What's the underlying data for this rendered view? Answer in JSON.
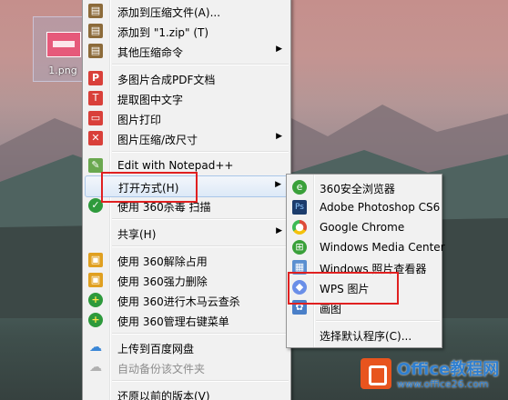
{
  "desktop": {
    "file_name": "1.png"
  },
  "context_menu": {
    "items": [
      {
        "label": "添加到压缩文件(A)...",
        "icon": "archive-icon",
        "color": "#7a5a2a"
      },
      {
        "label": "添加到 \"1.zip\" (T)",
        "icon": "archive-icon",
        "color": "#7a5a2a"
      },
      {
        "label": "其他压缩命令",
        "icon": "archive-icon",
        "color": "#7a5a2a"
      },
      {
        "label": "多图片合成PDF文档",
        "icon": "pdf-icon",
        "color": "#d9403a"
      },
      {
        "label": "提取图中文字",
        "icon": "text-extract-icon",
        "color": "#d9403a"
      },
      {
        "label": "图片打印",
        "icon": "print-icon",
        "color": "#d9403a"
      },
      {
        "label": "图片压缩/改尺寸",
        "icon": "resize-icon",
        "color": "#d9403a"
      },
      {
        "label": "Edit with Notepad++",
        "icon": "notepad-icon",
        "color": "#6aa84f"
      },
      {
        "label": "打开方式(H)",
        "icon": "",
        "color": ""
      },
      {
        "label": "使用 360杀毒 扫描",
        "icon": "shield-icon",
        "color": "#2e9a3c"
      },
      {
        "label": "共享(H)",
        "icon": "",
        "color": ""
      },
      {
        "label": "使用 360解除占用",
        "icon": "unlock-icon",
        "color": "#e0a020"
      },
      {
        "label": "使用 360强力删除",
        "icon": "delete-icon",
        "color": "#e0a020"
      },
      {
        "label": "使用 360进行木马云查杀",
        "icon": "plus-icon",
        "color": "#2e9a3c"
      },
      {
        "label": "使用 360管理右键菜单",
        "icon": "plus-icon",
        "color": "#2e9a3c"
      },
      {
        "label": "上传到百度网盘",
        "icon": "cloud-icon",
        "color": "#3a86d6"
      },
      {
        "label": "自动备份该文件夹",
        "icon": "cloud-icon",
        "color": "#b0b0b0"
      },
      {
        "label": "还原以前的版本(V)",
        "icon": "",
        "color": ""
      }
    ]
  },
  "open_with_submenu": {
    "items": [
      {
        "label": "360安全浏览器",
        "icon": "browser-360-icon",
        "color": "#3aa03a"
      },
      {
        "label": "Adobe Photoshop CS6",
        "icon": "photoshop-icon",
        "color": "#1c3c6c"
      },
      {
        "label": "Google Chrome",
        "icon": "chrome-icon",
        "color": "#dd4b39"
      },
      {
        "label": "Windows Media Center",
        "icon": "media-center-icon",
        "color": "#3aa03a"
      },
      {
        "label": "Windows 照片查看器",
        "icon": "photo-viewer-icon",
        "color": "#5a8fd0"
      },
      {
        "label": "WPS 图片",
        "icon": "wps-picture-icon",
        "color": "#6a8fe8"
      },
      {
        "label": "画图",
        "icon": "paint-icon",
        "color": "#4a7fc8"
      },
      {
        "label": "选择默认程序(C)...",
        "icon": "",
        "color": ""
      }
    ]
  },
  "watermark": {
    "title": "Office教程网",
    "url": "www.office26.com"
  }
}
